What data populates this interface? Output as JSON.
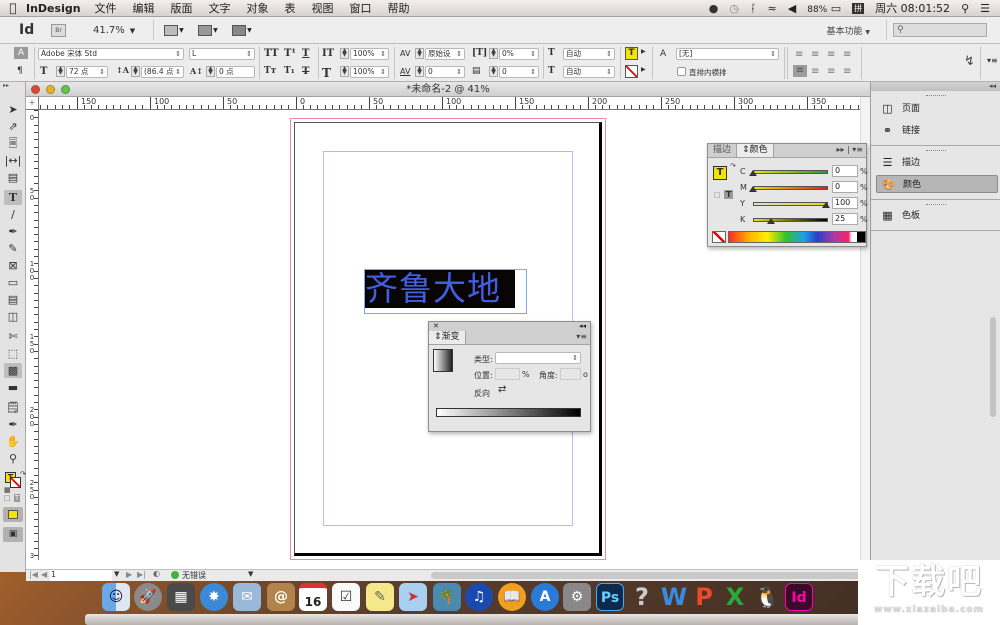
{
  "menubar": {
    "app_name": "InDesign",
    "menus": [
      "文件",
      "编辑",
      "版面",
      "文字",
      "对象",
      "表",
      "视图",
      "窗口",
      "帮助"
    ],
    "battery": "88%",
    "clock": "周六 08:01:52"
  },
  "appbar": {
    "logo": "Id",
    "bridge_label": "Br",
    "zoom_level": "41.7%",
    "workspace": "基本功能",
    "search_placeholder": ""
  },
  "control": {
    "font_family": "Adobe 宋体 Std",
    "font_style": "L",
    "font_size": "72 点",
    "leading": "(86.4 点",
    "baseline_shift": "0 点",
    "vertical_scale": "100%",
    "horizontal_scale": "100%",
    "kerning": "原始设",
    "tracking": "0",
    "tsume": "0%",
    "grid_spacing": "0",
    "char_before": "自动",
    "char_after": "自动",
    "language": "[无]",
    "tate_chu_yoko_label": "直排内横排"
  },
  "document": {
    "title": "*未命名-2 @ 41%",
    "text_content": "齐鲁大地",
    "hruler_labels": [
      "150",
      "100",
      "50",
      "0",
      "50",
      "100",
      "150",
      "200",
      "250",
      "300",
      "350"
    ],
    "vruler_labels": [
      "0",
      "50",
      "100",
      "150",
      "200",
      "250",
      "3"
    ]
  },
  "statusbar": {
    "page_number": "1",
    "preflight_status": "无错误"
  },
  "color_panel": {
    "tabs": [
      "描边",
      "颜色"
    ],
    "active_tab": "颜色",
    "channels": [
      {
        "label": "C",
        "value": "0",
        "fraction": 0
      },
      {
        "label": "M",
        "value": "0",
        "fraction": 0
      },
      {
        "label": "Y",
        "value": "100",
        "fraction": 1.0
      },
      {
        "label": "K",
        "value": "25",
        "fraction": 0.25
      }
    ],
    "unit": "%",
    "colors": {
      "cyan": "#2a9a3a",
      "magenta": "#e02020",
      "yellow": "#e8d800",
      "black": "#000000"
    }
  },
  "dock_panels": {
    "groups": [
      [
        {
          "label": "页面",
          "icon": "pages-icon"
        },
        {
          "label": "链接",
          "icon": "links-icon"
        }
      ],
      [
        {
          "label": "描边",
          "icon": "stroke-icon"
        },
        {
          "label": "颜色",
          "icon": "color-icon",
          "active": true
        }
      ],
      [
        {
          "label": "色板",
          "icon": "swatches-icon"
        }
      ]
    ]
  },
  "gradient_panel": {
    "tab": "渐变",
    "type_label": "类型:",
    "type_value": "",
    "position_label": "位置:",
    "position_value": "",
    "position_unit": "%",
    "angle_label": "角度:",
    "angle_value": "",
    "angle_unit": "o",
    "reverse_label": "反向"
  },
  "os_dock": {
    "apps": [
      "Finder",
      "Launchpad",
      "Mission Control",
      "Safari",
      "Mail",
      "Contacts",
      "Calendar",
      "Reminders",
      "Notes",
      "Maps",
      "iPhoto",
      "iTunes",
      "iBooks",
      "App Store",
      "System Preferences",
      "Photoshop",
      "Help",
      "WPS Writer",
      "WPS Presentation",
      "WPS Spreadsheets",
      "QQ",
      "InDesign"
    ],
    "calendar_day": "16"
  },
  "watermark": {
    "text": "下载吧",
    "url": "www.xiazaiba.com"
  }
}
